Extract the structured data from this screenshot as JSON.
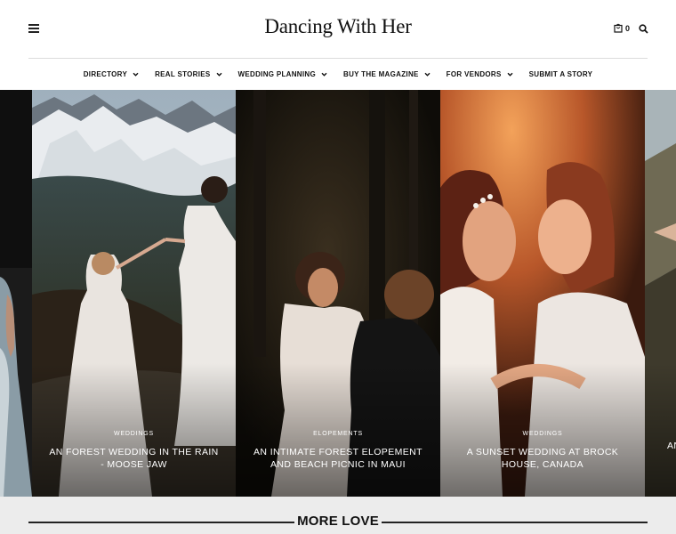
{
  "header": {
    "site_title": "Dancing With Her",
    "cart_count": "0"
  },
  "nav": {
    "items": [
      {
        "label": "DIRECTORY",
        "has_dropdown": true
      },
      {
        "label": "REAL STORIES",
        "has_dropdown": true
      },
      {
        "label": "WEDDING PLANNING",
        "has_dropdown": true
      },
      {
        "label": "BUY THE MAGAZINE",
        "has_dropdown": true
      },
      {
        "label": "FOR VENDORS",
        "has_dropdown": true
      },
      {
        "label": "SUBMIT A STORY",
        "has_dropdown": false
      }
    ]
  },
  "slides": [
    {
      "category": "WEDDINGS",
      "title": "AN FOREST WEDDING IN THE RAIN - MOOSE JAW"
    },
    {
      "category": "ELOPEMENTS",
      "title": "AN INTIMATE FOREST ELOPEMENT AND BEACH PICNIC IN MAUI"
    },
    {
      "category": "WEDDINGS",
      "title": "A SUNSET WEDDING AT BROCK HOUSE, CANADA"
    },
    {
      "category": "",
      "title": "AN"
    }
  ],
  "section": {
    "more_title": "MORE LOVE"
  },
  "colors": {
    "accent": "#111111",
    "section_bg": "#ececec"
  }
}
